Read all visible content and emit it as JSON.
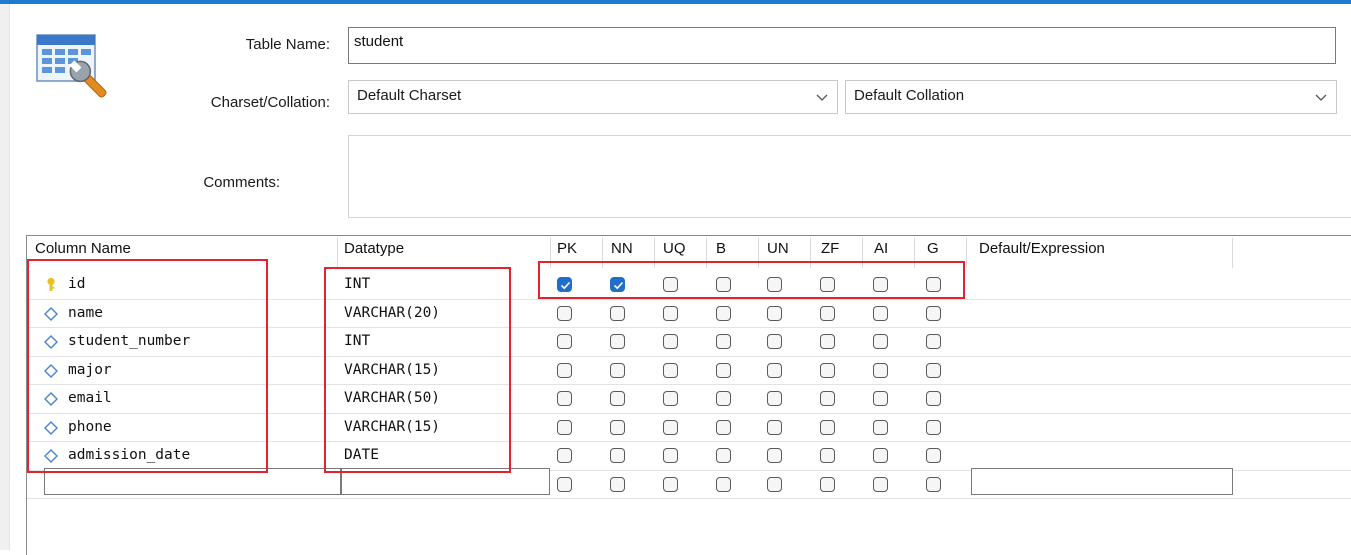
{
  "form": {
    "table_name_label": "Table Name:",
    "table_name_value": "student",
    "charset_label": "Charset/Collation:",
    "charset_value": "Default Charset",
    "collation_value": "Default Collation",
    "comments_label": "Comments:",
    "comments_value": ""
  },
  "grid": {
    "headers": {
      "column_name": "Column Name",
      "datatype": "Datatype",
      "pk": "PK",
      "nn": "NN",
      "uq": "UQ",
      "b": "B",
      "un": "UN",
      "zf": "ZF",
      "ai": "AI",
      "g": "G",
      "default": "Default/Expression"
    },
    "rows": [
      {
        "name": "id",
        "type": "INT",
        "icon": "key-icon",
        "pk": true,
        "nn": true,
        "uq": false,
        "b": false,
        "un": false,
        "zf": false,
        "ai": false,
        "g": false
      },
      {
        "name": "name",
        "type": "VARCHAR(20)",
        "icon": "diamond-icon",
        "pk": false,
        "nn": false,
        "uq": false,
        "b": false,
        "un": false,
        "zf": false,
        "ai": false,
        "g": false
      },
      {
        "name": "student_number",
        "type": "INT",
        "icon": "diamond-icon",
        "pk": false,
        "nn": false,
        "uq": false,
        "b": false,
        "un": false,
        "zf": false,
        "ai": false,
        "g": false
      },
      {
        "name": "major",
        "type": "VARCHAR(15)",
        "icon": "diamond-icon",
        "pk": false,
        "nn": false,
        "uq": false,
        "b": false,
        "un": false,
        "zf": false,
        "ai": false,
        "g": false
      },
      {
        "name": "email",
        "type": "VARCHAR(50)",
        "icon": "diamond-icon",
        "pk": false,
        "nn": false,
        "uq": false,
        "b": false,
        "un": false,
        "zf": false,
        "ai": false,
        "g": false
      },
      {
        "name": "phone",
        "type": "VARCHAR(15)",
        "icon": "diamond-icon",
        "pk": false,
        "nn": false,
        "uq": false,
        "b": false,
        "un": false,
        "zf": false,
        "ai": false,
        "g": false
      },
      {
        "name": "admission_date",
        "type": "DATE",
        "icon": "diamond-icon",
        "pk": false,
        "nn": false,
        "uq": false,
        "b": false,
        "un": false,
        "zf": false,
        "ai": false,
        "g": false
      }
    ]
  },
  "colors": {
    "accent": "#1f78d1",
    "checked": "#1f6fc8",
    "annotation": "#e2222c"
  }
}
